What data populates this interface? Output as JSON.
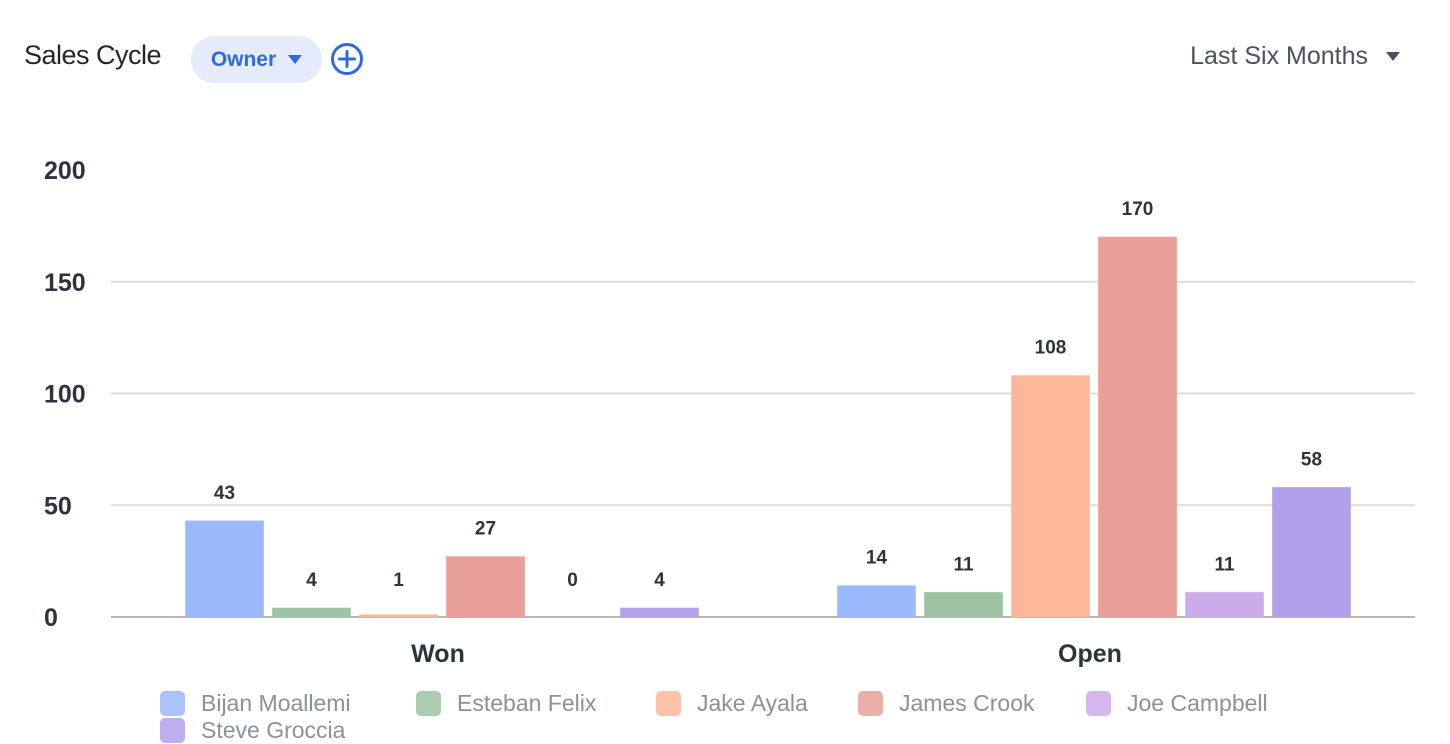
{
  "header": {
    "title": "Sales Cycle",
    "group_by_label": "Owner",
    "add_icon": "plus-circle-icon",
    "date_range": "Last Six Months"
  },
  "colors": {
    "accent": "#2d6be3",
    "pill_bg": "#e6ebfb"
  },
  "chart_data": {
    "type": "bar",
    "title": "Sales Cycle",
    "xlabel": "",
    "ylabel": "",
    "categories": [
      "Won",
      "Open"
    ],
    "ylim": [
      0,
      200
    ],
    "yticks": [
      "0",
      "50",
      "100",
      "150",
      "200"
    ],
    "grid": true,
    "legend_position": "bottom",
    "series": [
      {
        "name": "Bijan Moallemi",
        "color": "#9bb8fb",
        "values": [
          43,
          14
        ]
      },
      {
        "name": "Esteban Felix",
        "color": "#9dc3a3",
        "values": [
          4,
          11
        ]
      },
      {
        "name": "Jake Ayala",
        "color": "#fdb899",
        "values": [
          1,
          108
        ]
      },
      {
        "name": "James Crook",
        "color": "#e8a099",
        "values": [
          27,
          170
        ]
      },
      {
        "name": "Joe Campbell",
        "color": "#cdabea",
        "values": [
          0,
          11
        ]
      },
      {
        "name": "Steve Groccia",
        "color": "#b1a0ea",
        "values": [
          4,
          58
        ]
      }
    ]
  }
}
